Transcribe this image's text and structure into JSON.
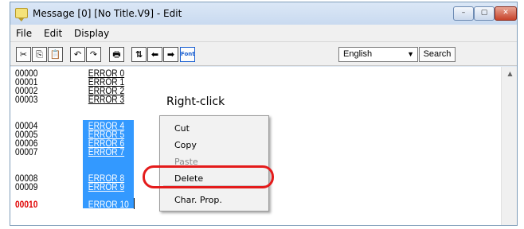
{
  "window": {
    "title": "Message [0] [No Title.V9] - Edit"
  },
  "window_controls": {
    "minimize": "–",
    "maximize": "▢",
    "close": "✕"
  },
  "menu": [
    "File",
    "Edit",
    "Display"
  ],
  "toolbar": {
    "buttons": [
      {
        "name": "cut-icon",
        "glyph": "✂"
      },
      {
        "name": "copy-icon",
        "glyph": "⎘"
      },
      {
        "name": "paste-icon",
        "glyph": "📋"
      },
      {
        "name": "undo-icon",
        "glyph": "↶"
      },
      {
        "name": "redo-icon",
        "glyph": "↷"
      },
      {
        "name": "print-icon",
        "glyph": "🖶"
      },
      {
        "name": "goto-icon",
        "glyph": "⇅"
      },
      {
        "name": "back-arrow-icon",
        "glyph": "⬅"
      },
      {
        "name": "forward-arrow-icon",
        "glyph": "➡"
      },
      {
        "name": "font-icon",
        "glyph": "Font"
      }
    ],
    "language": "English",
    "language_arrow": "▼",
    "search_label": "Search"
  },
  "editor": {
    "lines": [
      {
        "no": "00000",
        "text": "ERROR 0"
      },
      {
        "no": "00001",
        "text": "ERROR 1"
      },
      {
        "no": "00002",
        "text": "ERROR 2"
      },
      {
        "no": "00003",
        "text": "ERROR 3"
      },
      {
        "no": "00004",
        "text": "ERROR 4"
      },
      {
        "no": "00005",
        "text": "ERROR 5"
      },
      {
        "no": "00006",
        "text": "ERROR 6"
      },
      {
        "no": "00007",
        "text": "ERROR 7"
      },
      {
        "no": "00008",
        "text": "ERROR 8"
      },
      {
        "no": "00009",
        "text": "ERROR 9"
      },
      {
        "no": "00010",
        "text": "ERROR 10"
      }
    ],
    "selected_from": 4,
    "current_line": 10
  },
  "scroll_up": "▲",
  "annotation": {
    "label": "Right-click",
    "color": "#e41b1b"
  },
  "context_menu": {
    "items": [
      {
        "label": "Cut",
        "enabled": true
      },
      {
        "label": "Copy",
        "enabled": true
      },
      {
        "label": "Paste",
        "enabled": false
      },
      {
        "label": "Delete",
        "enabled": true,
        "highlighted": true
      },
      {
        "label": "Char. Prop.",
        "enabled": true
      }
    ]
  },
  "colors": {
    "selection": "#3399ff",
    "current_line_number": "#e00000",
    "accent": "#e41b1b"
  }
}
